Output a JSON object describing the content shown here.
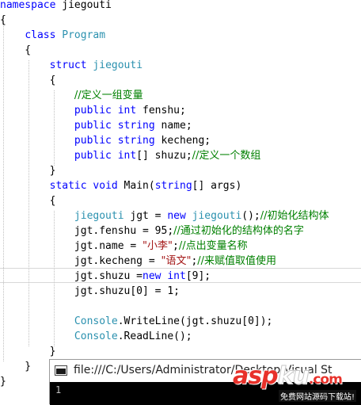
{
  "code_lines": [
    [
      {
        "t": "namespace",
        "c": "kw"
      },
      {
        "t": " jiegouti",
        "c": "txt"
      }
    ],
    [
      {
        "t": "{",
        "c": "txt"
      }
    ],
    [
      {
        "t": "    ",
        "c": "txt"
      },
      {
        "t": "class",
        "c": "kw"
      },
      {
        "t": " ",
        "c": "txt"
      },
      {
        "t": "Program",
        "c": "type"
      }
    ],
    [
      {
        "t": "    {",
        "c": "txt"
      }
    ],
    [
      {
        "t": "        ",
        "c": "txt"
      },
      {
        "t": "struct",
        "c": "kw"
      },
      {
        "t": " ",
        "c": "txt"
      },
      {
        "t": "jiegouti",
        "c": "type"
      }
    ],
    [
      {
        "t": "        {",
        "c": "txt"
      }
    ],
    [
      {
        "t": "            ",
        "c": "txt"
      },
      {
        "t": "//定义一组变量",
        "c": "cm"
      }
    ],
    [
      {
        "t": "            ",
        "c": "txt"
      },
      {
        "t": "public",
        "c": "kw"
      },
      {
        "t": " ",
        "c": "txt"
      },
      {
        "t": "int",
        "c": "kw"
      },
      {
        "t": " fenshu;",
        "c": "txt"
      }
    ],
    [
      {
        "t": "            ",
        "c": "txt"
      },
      {
        "t": "public",
        "c": "kw"
      },
      {
        "t": " ",
        "c": "txt"
      },
      {
        "t": "string",
        "c": "kw"
      },
      {
        "t": " name;",
        "c": "txt"
      }
    ],
    [
      {
        "t": "            ",
        "c": "txt"
      },
      {
        "t": "public",
        "c": "kw"
      },
      {
        "t": " ",
        "c": "txt"
      },
      {
        "t": "string",
        "c": "kw"
      },
      {
        "t": " kecheng;",
        "c": "txt"
      }
    ],
    [
      {
        "t": "            ",
        "c": "txt"
      },
      {
        "t": "public",
        "c": "kw"
      },
      {
        "t": " ",
        "c": "txt"
      },
      {
        "t": "int",
        "c": "kw"
      },
      {
        "t": "[] shuzu;",
        "c": "txt"
      },
      {
        "t": "//定义一个数组",
        "c": "cm"
      }
    ],
    [
      {
        "t": "        }",
        "c": "txt"
      }
    ],
    [
      {
        "t": "        ",
        "c": "txt"
      },
      {
        "t": "static",
        "c": "kw"
      },
      {
        "t": " ",
        "c": "txt"
      },
      {
        "t": "void",
        "c": "kw"
      },
      {
        "t": " Main(",
        "c": "txt"
      },
      {
        "t": "string",
        "c": "kw"
      },
      {
        "t": "[] args)",
        "c": "txt"
      }
    ],
    [
      {
        "t": "        {",
        "c": "txt"
      }
    ],
    [
      {
        "t": "            ",
        "c": "txt"
      },
      {
        "t": "jiegouti",
        "c": "type"
      },
      {
        "t": " jgt = ",
        "c": "txt"
      },
      {
        "t": "new",
        "c": "kw"
      },
      {
        "t": " ",
        "c": "txt"
      },
      {
        "t": "jiegouti",
        "c": "type"
      },
      {
        "t": "();",
        "c": "txt"
      },
      {
        "t": "//初始化结构体",
        "c": "cm"
      }
    ],
    [
      {
        "t": "            jgt.fenshu = 95;",
        "c": "txt"
      },
      {
        "t": "//通过初始化的结构体的名字",
        "c": "cm"
      }
    ],
    [
      {
        "t": "            jgt.name = ",
        "c": "txt"
      },
      {
        "t": "\"小李\"",
        "c": "str"
      },
      {
        "t": ";",
        "c": "txt"
      },
      {
        "t": "//点出变量名称",
        "c": "cm"
      }
    ],
    [
      {
        "t": "            jgt.kecheng = ",
        "c": "txt"
      },
      {
        "t": "\"语文\"",
        "c": "str"
      },
      {
        "t": ";",
        "c": "txt"
      },
      {
        "t": "//来赋值取值使用",
        "c": "cm"
      }
    ],
    [
      {
        "t": "            jgt.shuzu =",
        "c": "txt"
      },
      {
        "t": "new",
        "c": "kw"
      },
      {
        "t": " ",
        "c": "txt"
      },
      {
        "t": "int",
        "c": "kw"
      },
      {
        "t": "[9];",
        "c": "txt"
      }
    ],
    [
      {
        "t": "            jgt.shuzu[0] = 1;",
        "c": "txt"
      }
    ],
    [
      {
        "t": "",
        "c": "txt"
      }
    ],
    [
      {
        "t": "            ",
        "c": "txt"
      },
      {
        "t": "Console",
        "c": "type"
      },
      {
        "t": ".WriteLine(jgt.shuzu[0]);",
        "c": "txt"
      }
    ],
    [
      {
        "t": "            ",
        "c": "txt"
      },
      {
        "t": "Console",
        "c": "type"
      },
      {
        "t": ".ReadLine();",
        "c": "txt"
      }
    ],
    [
      {
        "t": "        }",
        "c": "txt"
      }
    ],
    [
      {
        "t": "    }",
        "c": "txt"
      }
    ],
    [
      {
        "t": "}",
        "c": "txt"
      }
    ]
  ],
  "colors": {
    "keyword": "#0000ff",
    "type": "#2b91af",
    "comment": "#008000",
    "string": "#a31515",
    "text": "#000000"
  },
  "console": {
    "title": "file:///C:/Users/Administrator/Desktop/Visual St",
    "output": "1",
    "icon": "console-window-icon"
  },
  "watermark": {
    "logo_main": "asp",
    "logo_ku": "ku",
    "logo_cn": ".com",
    "subtitle": "免费网站源码下载站!"
  }
}
